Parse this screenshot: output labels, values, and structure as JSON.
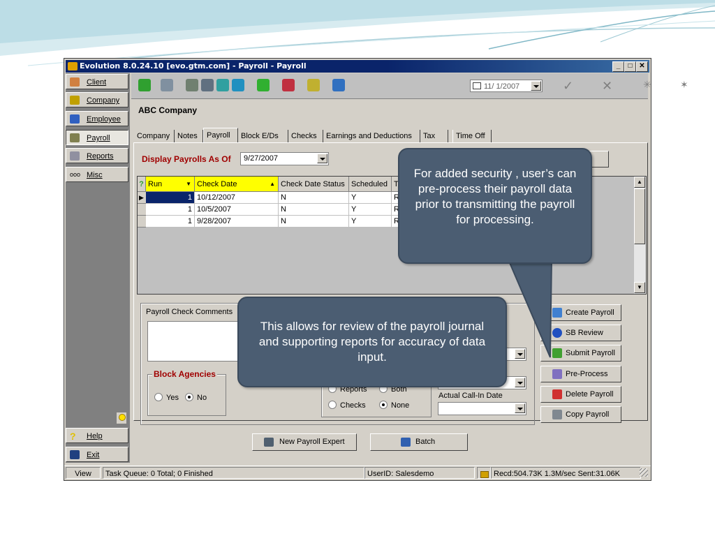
{
  "window": {
    "title": "Evolution 8.0.24.10 [evo.gtm.com] - Payroll - Payroll",
    "min": "_",
    "max": "□",
    "close": "✕"
  },
  "nav": {
    "items": [
      {
        "label": "Client"
      },
      {
        "label": "Company"
      },
      {
        "label": "Employee"
      },
      {
        "label": "Payroll"
      },
      {
        "label": "Reports"
      },
      {
        "label": "Misc"
      }
    ],
    "help": "Help",
    "exit": "Exit"
  },
  "toolbar": {
    "date": "11/ 1/2007"
  },
  "company_name": "ABC Company",
  "tabs": [
    "Company",
    "Notes",
    "Payroll",
    "Block E/Ds",
    "Checks",
    "Earnings and Deductions",
    "Tax",
    "Time Off"
  ],
  "display": {
    "label": "Display Payrolls As Of",
    "date": "9/27/2007"
  },
  "grid": {
    "columns": [
      "Run",
      "Check Date",
      "Check Date Status",
      "Scheduled",
      "T"
    ],
    "rows": [
      [
        "1",
        "10/12/2007",
        "N",
        "Y",
        "R"
      ],
      [
        "1",
        "10/5/2007",
        "N",
        "Y",
        "R"
      ],
      [
        "1",
        "9/28/2007",
        "N",
        "Y",
        "R"
      ]
    ]
  },
  "comments_label": "Payroll Check Comments",
  "block_agencies": {
    "title": "Block Agencies",
    "yes": "Yes",
    "no": "No"
  },
  "print_options": {
    "reports": "Reports",
    "both": "Both",
    "checks": "Checks",
    "none": "None"
  },
  "call_in_label": "Actual Call-In Date",
  "actions": [
    "Create Payroll",
    "SB Review",
    "Submit Payroll",
    "Pre-Process",
    "Delete Payroll",
    "Copy Payroll"
  ],
  "bottom": {
    "new_payroll": "New Payroll Expert",
    "batch": "Batch"
  },
  "status": {
    "view": "View",
    "queue": "Task Queue: 0 Total; 0 Finished",
    "user": "UserID: Salesdemo",
    "traffic": "Recd:504.73K  1.3M/sec  Sent:31.06K"
  },
  "callouts": {
    "security": "For added security , user’s can pre-process their payroll data prior to transmitting the payroll for processing.",
    "review": "This allows for review of the payroll journal and supporting reports for accuracy of data input."
  }
}
